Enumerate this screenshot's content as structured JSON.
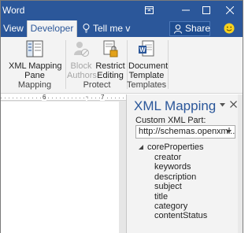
{
  "titlebar": {
    "app_title": "Word"
  },
  "tabs": {
    "view": "View",
    "developer": "Developer",
    "tell_me": "Tell me v",
    "share": "Share"
  },
  "ribbon": {
    "mapping": {
      "xml_mapping_pane_line1": "XML Mapping",
      "xml_mapping_pane_line2": "Pane",
      "group_label": "Mapping"
    },
    "protect": {
      "block_authors_line1": "Block",
      "block_authors_line2": "Authors",
      "restrict_editing_line1": "Restrict",
      "restrict_editing_line2": "Editing",
      "group_label": "Protect"
    },
    "templates": {
      "document_template_line1": "Document",
      "document_template_line2": "Template",
      "group_label": "Templates"
    }
  },
  "ruler": {
    "mark_6": "6",
    "mark_7": "7"
  },
  "xml_pane": {
    "title": "XML Mapping",
    "custom_part_label": "Custom XML Part:",
    "custom_part_value": "http://schemas.openxml...",
    "tree_root": "coreProperties",
    "tree_items": [
      "creator",
      "keywords",
      "description",
      "subject",
      "title",
      "category",
      "contentStatus"
    ]
  },
  "colors": {
    "accent": "#2b579a",
    "ribbon_bg": "#f3f3f3"
  }
}
